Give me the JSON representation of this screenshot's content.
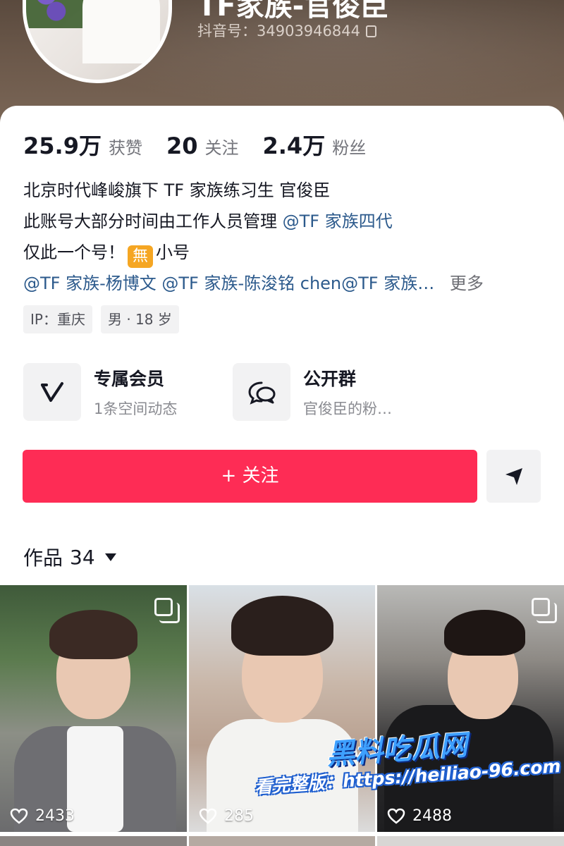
{
  "profile": {
    "name": "TF家族-官俊臣 ",
    "douyin_id": "抖音号：34903946844"
  },
  "stats": [
    {
      "value": "25.9万",
      "label": "获赞"
    },
    {
      "value": "20",
      "label": "关注"
    },
    {
      "value": "2.4万",
      "label": "粉丝"
    }
  ],
  "bio": {
    "line1": "北京时代峰峻旗下 TF 家族练习生 官俊臣",
    "line2_text": "此账号大部分时间由工作人员管理 ",
    "line2_link": "@TF 家族四代",
    "line3_text": "仅此一个号！",
    "line3_badge": "無",
    "line3_after": "小号",
    "line4_link": "@TF 家族-杨博文 @TF 家族-陈浚铭 chen@TF 家族…",
    "more": "更多"
  },
  "tags": {
    "ip": "IP：重庆",
    "gender_age": "男 · 18 岁"
  },
  "entries": {
    "member_title": "专属会员",
    "member_sub": "1条空间动态",
    "group_title": "公开群",
    "group_sub": "官俊臣的粉…"
  },
  "actions": {
    "follow": "+ 关注"
  },
  "works": {
    "label": "作品",
    "count": "34"
  },
  "videos": [
    {
      "likes": "2433"
    },
    {
      "likes": "285"
    },
    {
      "likes": "2488"
    }
  ],
  "watermark": {
    "title": "黑料吃瓜网",
    "url": "看完整版：https://heiliao-96.com"
  },
  "colors": {
    "follow_button": "#fe2c55",
    "link": "#2c5a8c",
    "banner": "#6b584a"
  }
}
